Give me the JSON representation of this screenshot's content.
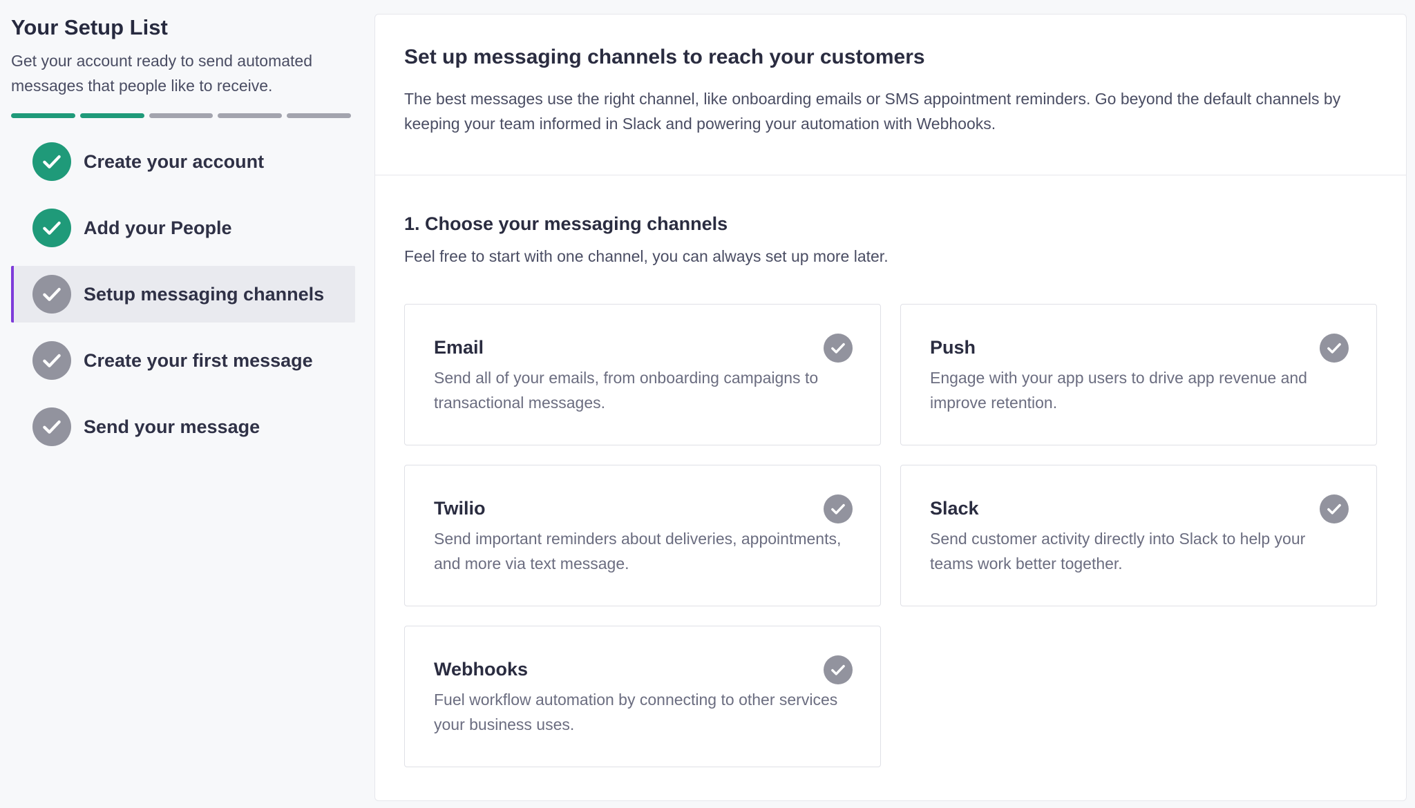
{
  "sidebar": {
    "title": "Your Setup List",
    "subtitle": "Get your account ready to send automated messages that people like to receive.",
    "progress": {
      "total": 5,
      "completed": 2,
      "done_color": "#1f9a79",
      "pending_color": "#a3a4ae"
    },
    "steps": [
      {
        "label": "Create your account",
        "status": "done",
        "icon": "check-circle-icon"
      },
      {
        "label": "Add your People",
        "status": "done",
        "icon": "check-circle-icon"
      },
      {
        "label": "Setup messaging channels",
        "status": "active",
        "icon": "check-circle-icon"
      },
      {
        "label": "Create your first message",
        "status": "pending",
        "icon": "check-circle-icon"
      },
      {
        "label": "Send your message",
        "status": "pending",
        "icon": "check-circle-icon"
      }
    ],
    "active_accent": "#7e3bd9"
  },
  "main": {
    "title": "Set up messaging channels to reach your customers",
    "description": "The best messages use the right channel, like onboarding emails or SMS appointment reminders. Go beyond the default channels by keeping your team informed in Slack and powering your automation with Webhooks.",
    "section": {
      "title": "1. Choose your messaging channels",
      "subtitle": "Feel free to start with one channel, you can always set up more later."
    },
    "channels": [
      {
        "name": "Email",
        "description": "Send all of your emails, from onboarding campaigns to transactional messages."
      },
      {
        "name": "Push",
        "description": "Engage with your app users to drive app revenue and improve retention."
      },
      {
        "name": "Twilio",
        "description": "Send important reminders about deliveries, appointments, and more via text message."
      },
      {
        "name": "Slack",
        "description": "Send customer activity directly into Slack to help your teams work better together."
      },
      {
        "name": "Webhooks",
        "description": "Fuel workflow automation by connecting to other services your business uses."
      }
    ]
  }
}
